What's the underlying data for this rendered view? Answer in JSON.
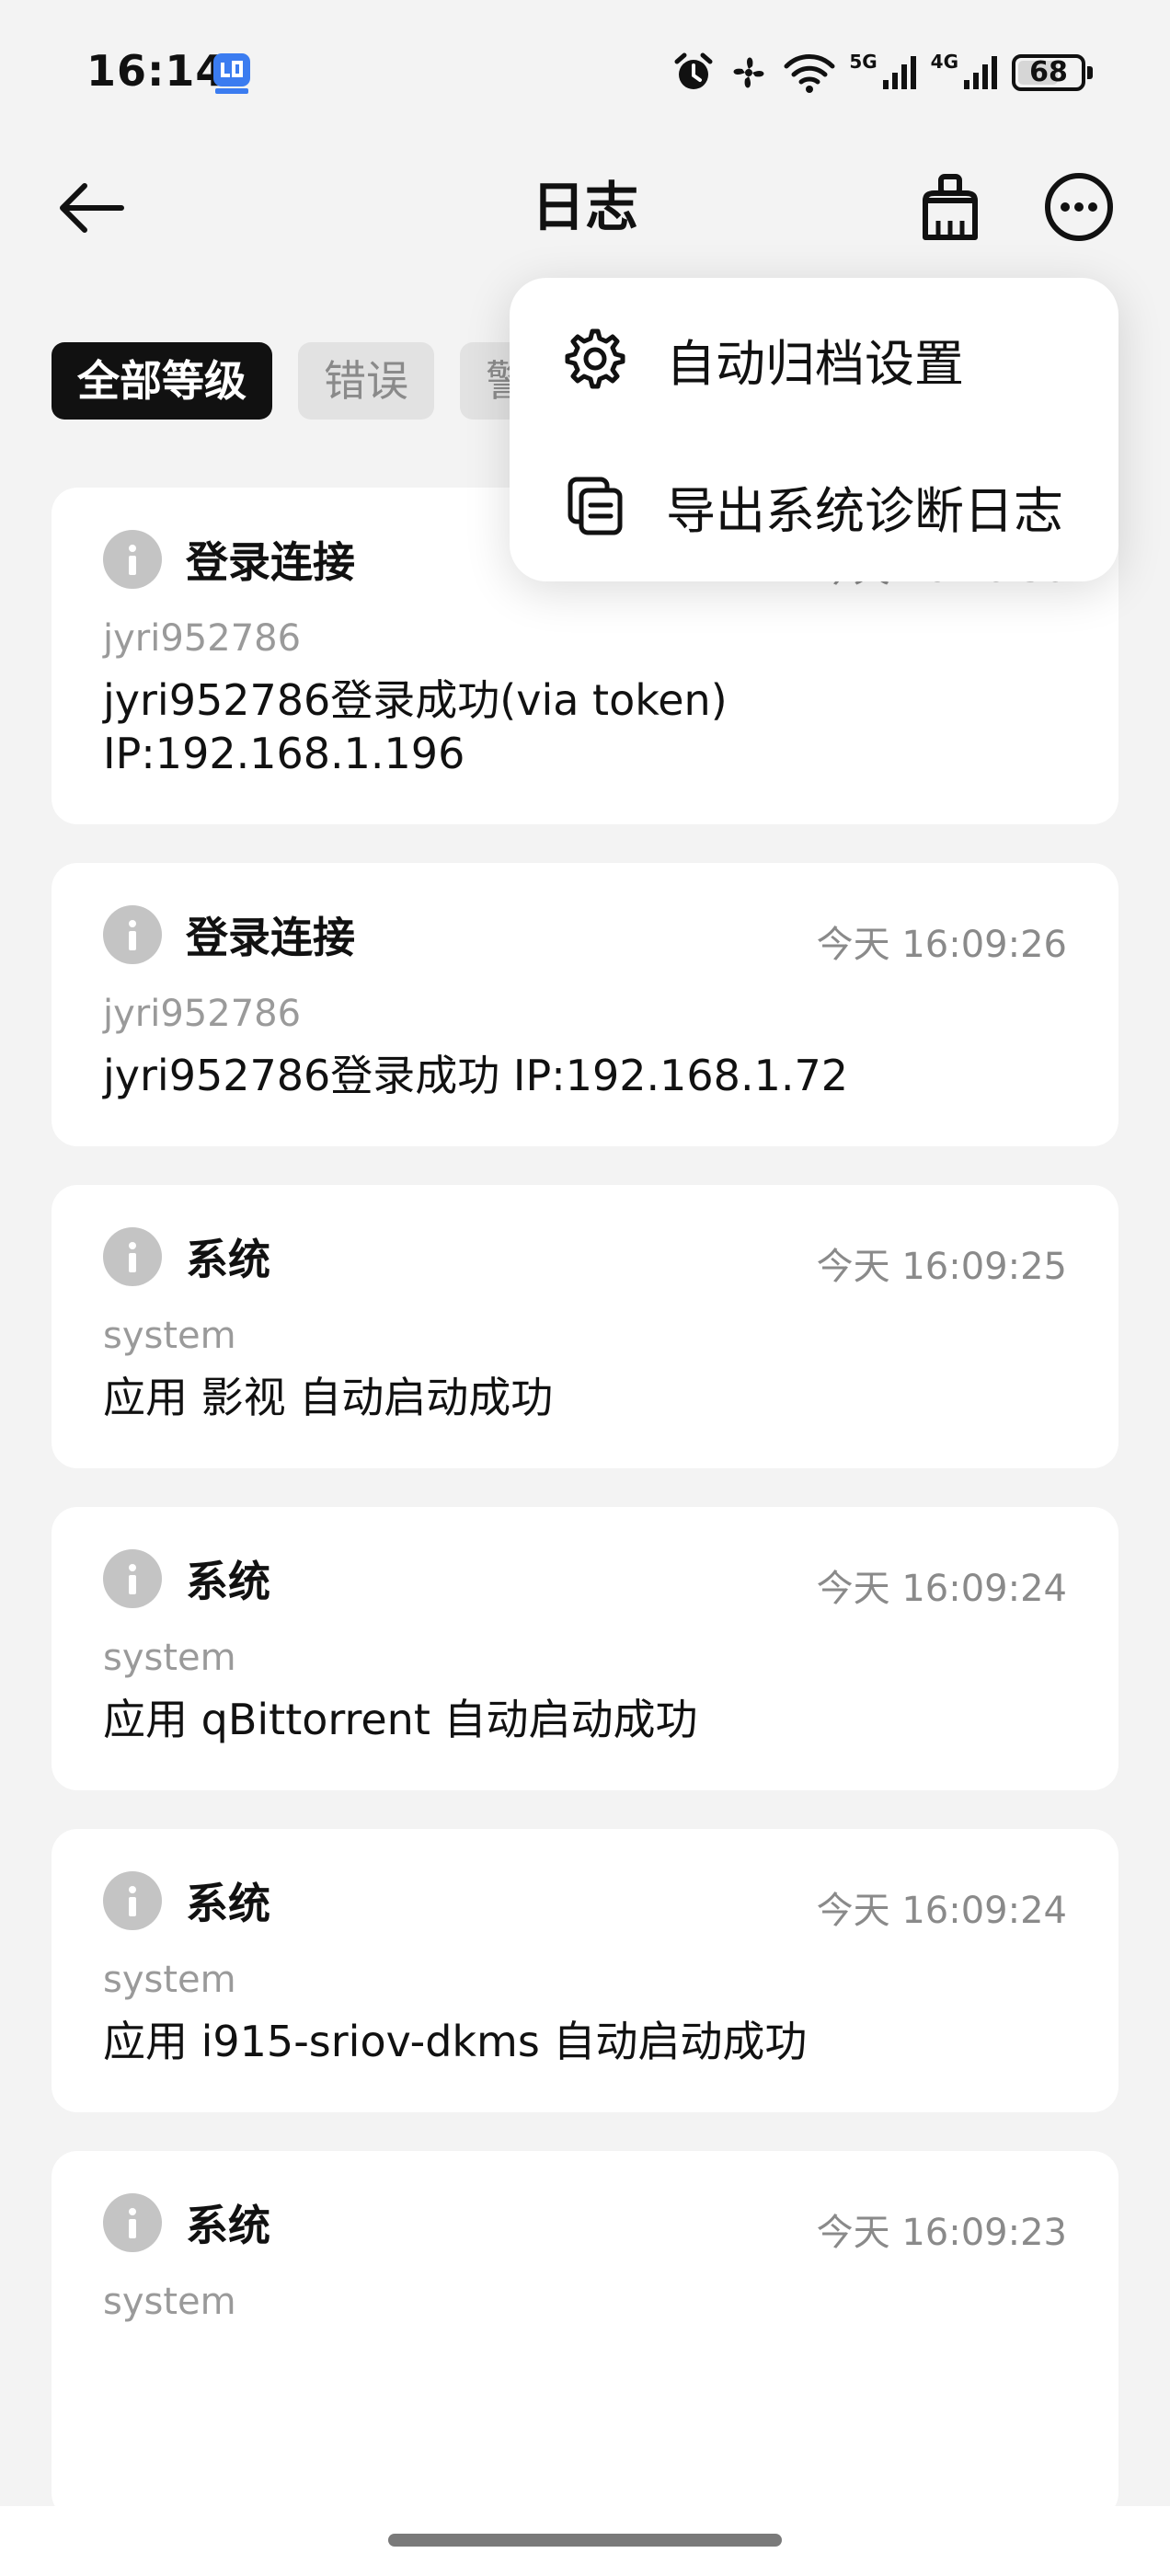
{
  "status_bar": {
    "time": "16:14",
    "network_1": "5G",
    "network_2": "4G",
    "battery": "68",
    "battery_level_percent": 68,
    "icons": [
      "app-notification-icon",
      "alarm-icon",
      "fan-icon",
      "wifi-icon",
      "signal-5g-icon",
      "signal-4g-icon",
      "battery-icon"
    ]
  },
  "header": {
    "title": "日志"
  },
  "filters": [
    {
      "label": "全部等级",
      "active": true
    },
    {
      "label": "错误",
      "active": false
    },
    {
      "label": "警",
      "active": false
    }
  ],
  "menu": {
    "items": [
      {
        "label": "自动归档设置",
        "icon": "gear-icon"
      },
      {
        "label": "导出系统诊断日志",
        "icon": "copy-icon"
      }
    ]
  },
  "logs": [
    {
      "category": "登录连接",
      "time": "今天 16:10:30",
      "user": "jyri952786",
      "message": "jyri952786登录成功(via token) IP:192.168.1.196"
    },
    {
      "category": "登录连接",
      "time": "今天 16:09:26",
      "user": "jyri952786",
      "message": "jyri952786登录成功 IP:192.168.1.72"
    },
    {
      "category": "系统",
      "time": "今天 16:09:25",
      "user": "system",
      "message": "应用 影视 自动启动成功"
    },
    {
      "category": "系统",
      "time": "今天 16:09:24",
      "user": "system",
      "message": "应用 qBittorrent 自动启动成功"
    },
    {
      "category": "系统",
      "time": "今天 16:09:24",
      "user": "system",
      "message": "应用 i915-sriov-dkms 自动启动成功"
    },
    {
      "category": "系统",
      "time": "今天 16:09:23",
      "user": "system",
      "message": ""
    }
  ]
}
